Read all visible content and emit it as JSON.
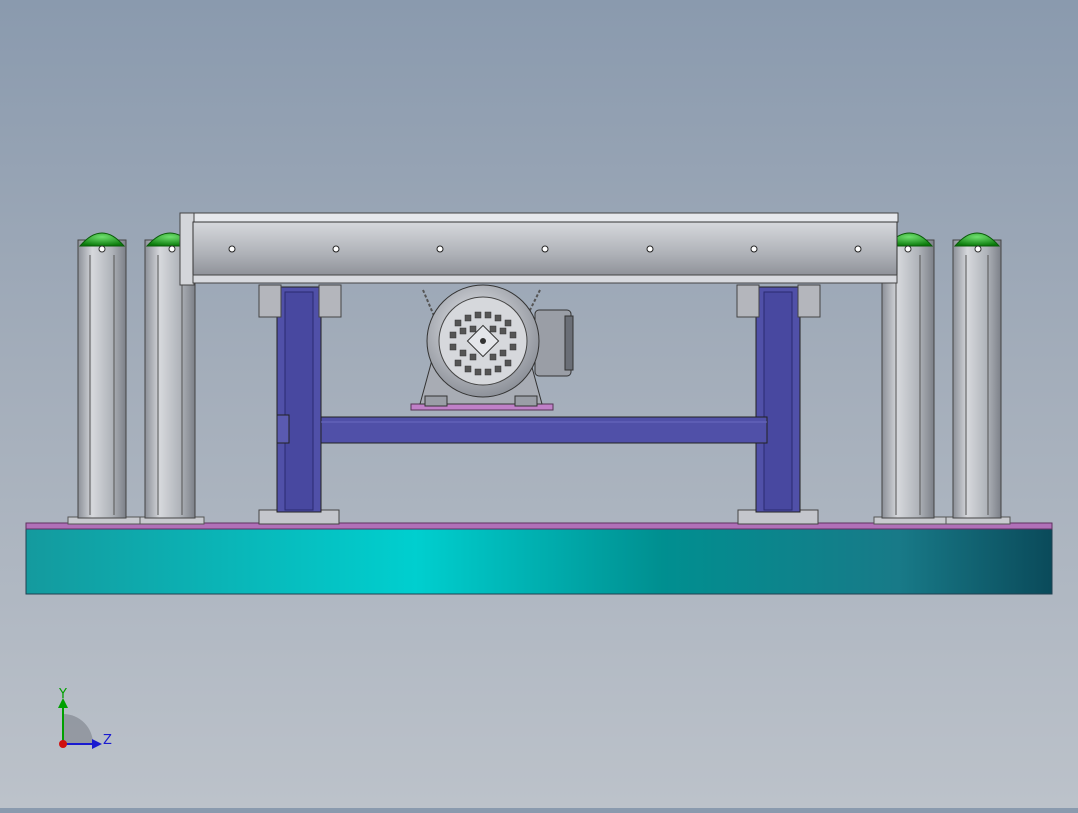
{
  "viewport": {
    "view": "cad-model-side-view",
    "background_top": "#8a9aae",
    "background_bottom": "#bcc2ca"
  },
  "model": {
    "base_plate_color": "#00a8a8",
    "base_top_strip_color": "#b070b8",
    "frame_color": "#5050a8",
    "conveyor_color": "#b4b6bc",
    "motor_color": "#c0c4cc",
    "post_cap_color": "#1eb01e",
    "post_color": "#b8bcc4"
  },
  "triad": {
    "y_label": "Y",
    "z_label": "Z",
    "y_color": "#00a000",
    "z_color": "#1a1ad0",
    "origin_color": "#d01010"
  }
}
